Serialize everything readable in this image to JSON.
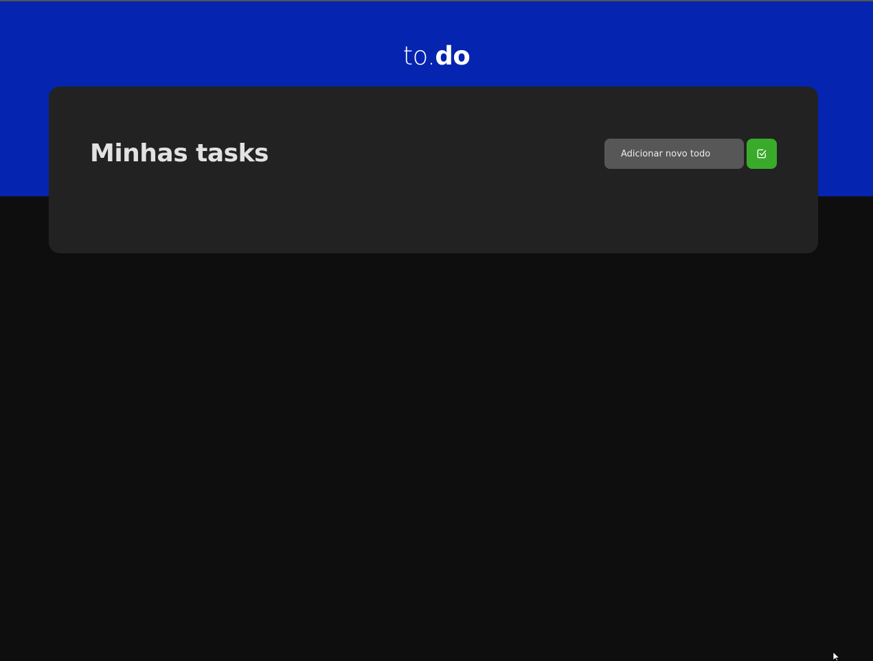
{
  "app": {
    "logo_light": "to.",
    "logo_bold": "do"
  },
  "tasks": {
    "title": "Minhas tasks",
    "new_todo_placeholder": "Adicionar novo todo",
    "new_todo_value": "",
    "add_button_icon": "check-square-icon"
  },
  "colors": {
    "header": "#0524b0",
    "background": "#0e0e0e",
    "card": "#222222",
    "input": "#575757",
    "accent": "#3aaa2a"
  }
}
